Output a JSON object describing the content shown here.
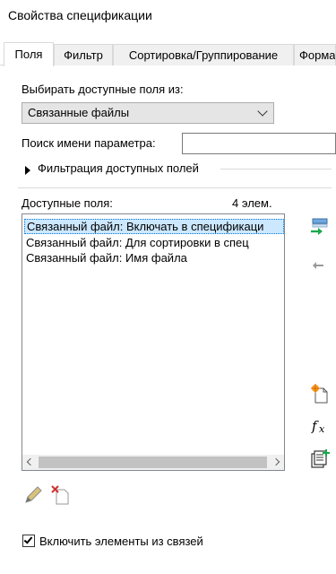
{
  "window": {
    "title": "Свойства спецификации"
  },
  "tabs": [
    {
      "label": "Поля",
      "active": true
    },
    {
      "label": "Фильтр",
      "active": false
    },
    {
      "label": "Сортировка/Группирование",
      "active": false
    },
    {
      "label": "Форма",
      "active": false
    }
  ],
  "fields": {
    "source_label": "Выбирать доступные поля из:",
    "source_value": "Связанные файлы",
    "search_label": "Поиск имени параметра:",
    "search_value": "",
    "filter_expander_label": "Фильтрация доступных полей",
    "available_label": "Доступные поля:",
    "available_count": "4 элем.",
    "available_items": [
      {
        "label": "Связанный файл: Включать в спецификаци",
        "selected": true
      },
      {
        "label": "Связанный файл: Для сортировки в спец",
        "selected": false
      },
      {
        "label": "Связанный файл: Имя файла",
        "selected": false
      }
    ],
    "include_links_label": "Включить элементы из связей",
    "include_links_checked": true
  },
  "icons": {
    "add": "add-field-icon",
    "remove": "remove-field-icon",
    "new_parameter": "new-parameter-icon",
    "formula": "formula-icon",
    "combine": "combine-parameters-icon",
    "edit": "edit-icon",
    "delete": "delete-icon"
  },
  "colors": {
    "selection": "#cce8ff",
    "add_arrow": "#1aa84a",
    "accent": "#0078d7"
  }
}
